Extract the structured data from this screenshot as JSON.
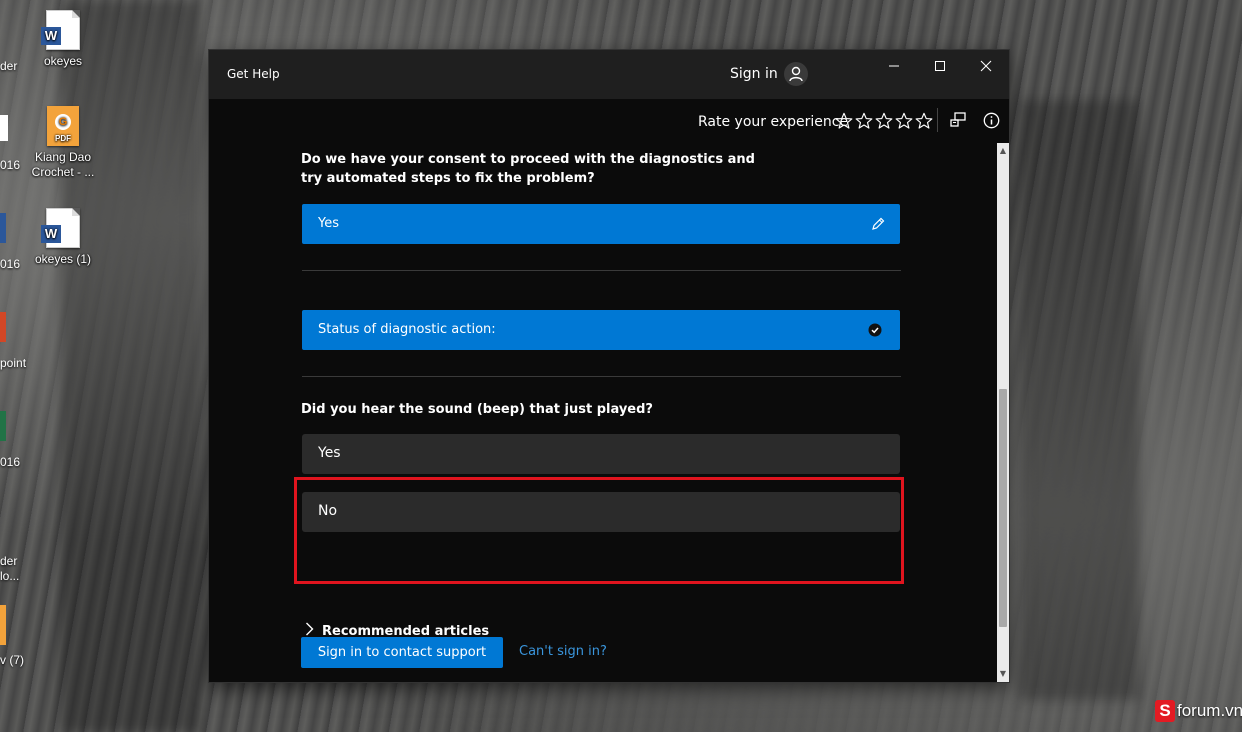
{
  "desktop": {
    "icons": [
      {
        "name": "okeyes",
        "type": "word"
      },
      {
        "name": "Kiang Dao Crochet - ...",
        "type": "pdf"
      },
      {
        "name": "okeyes (1)",
        "type": "word"
      }
    ],
    "edge_labels": [
      "der",
      "016",
      "016",
      "point",
      "016",
      "der",
      "lo...",
      "v (7)"
    ]
  },
  "window": {
    "title": "Get Help",
    "sign_in": "Sign in",
    "rate_label": "Rate your experience",
    "star_count": 5
  },
  "content": {
    "consent_question": "Do we have your consent to proceed with the diagnostics and try automated steps to fix the problem?",
    "consent_answer": "Yes",
    "status_label": "Status of diagnostic action:",
    "sound_question": "Did you hear the sound (beep) that just played?",
    "options": [
      "Yes",
      "No"
    ],
    "recommended": "Recommended articles",
    "contact_button": "Sign in to contact support",
    "cant_sign_in": "Can't sign in?"
  },
  "watermark": {
    "badge": "S",
    "text": "forum.vn"
  },
  "colors": {
    "accent": "#0078d4",
    "highlight": "#e0141e",
    "link": "#3a96dd"
  }
}
